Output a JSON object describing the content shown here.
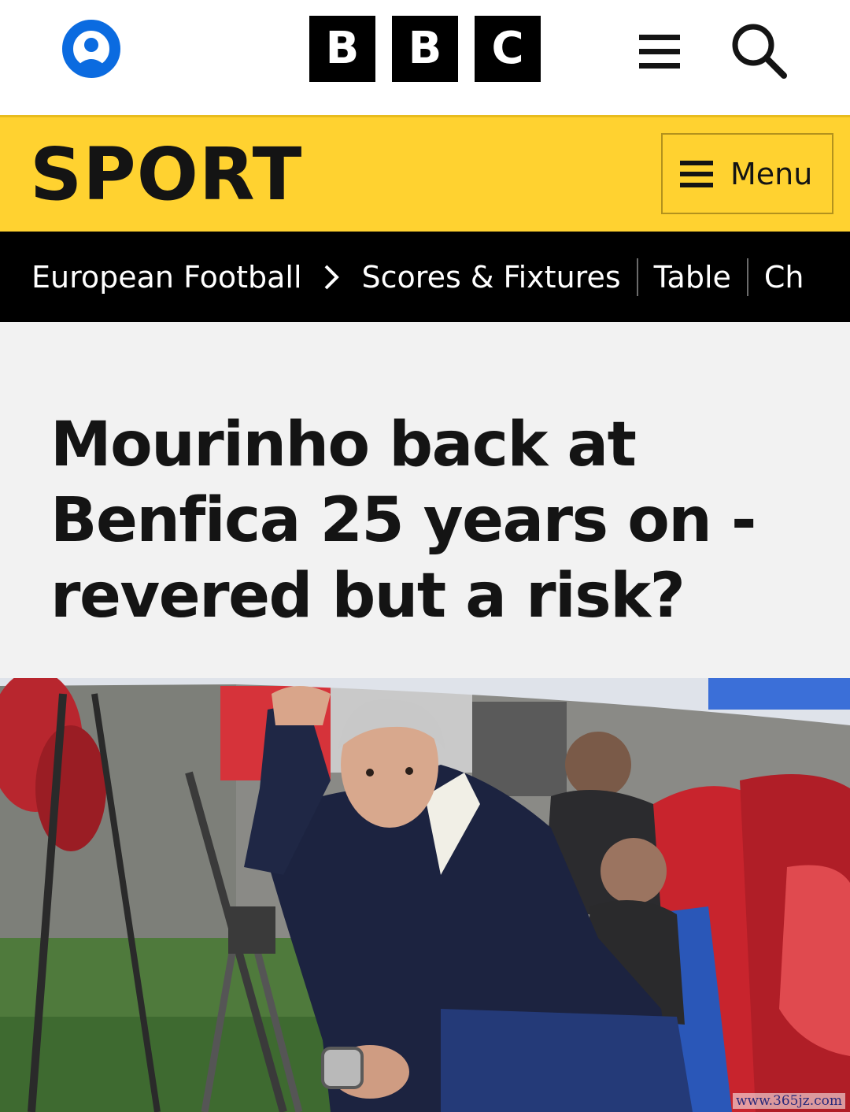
{
  "header": {
    "logo_letters": [
      "B",
      "B",
      "C"
    ],
    "account_icon": "account-icon",
    "menu_icon": "hamburger-icon",
    "search_icon": "search-icon"
  },
  "sport": {
    "title": "SPORT",
    "menu_label": "Menu",
    "accent_color": "#ffd230"
  },
  "subnav": {
    "items": [
      "European Football",
      "Scores & Fixtures",
      "Table",
      "Ch"
    ],
    "chevron_icon": "chevron-right-icon"
  },
  "article": {
    "headline_lines": [
      "Mourinho back at",
      "Benfica 25 years on -",
      "revered but a risk?"
    ]
  },
  "watermark": "www.365jz.com"
}
